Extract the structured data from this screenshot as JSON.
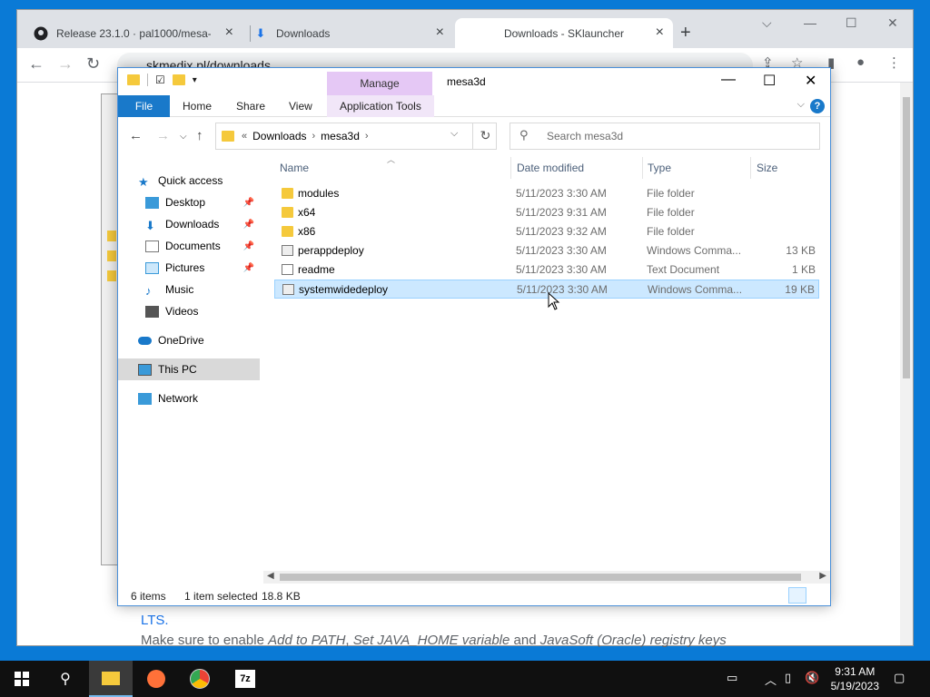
{
  "browser": {
    "tabs": [
      {
        "title": "Release 23.1.0 · pal1000/mesa-d",
        "icon": "github-icon"
      },
      {
        "title": "Downloads",
        "icon": "download-icon"
      },
      {
        "title": "Downloads - SKlauncher",
        "icon": "none"
      }
    ],
    "url": "skmedix.pl/downloads",
    "page": {
      "lts_link": "LTS.",
      "instruction_prefix": "Make sure to enable ",
      "opt1": "Add to PATH",
      "comma": ", ",
      "opt2": "Set JAVA_HOME variable",
      "and": " and ",
      "opt3": "JavaSoft (Oracle) registry keys"
    }
  },
  "explorer": {
    "title": "mesa3d",
    "context_tab": "Manage",
    "ribbon_tabs": [
      "File",
      "Home",
      "Share",
      "View",
      "Application Tools"
    ],
    "breadcrumb": [
      "Downloads",
      "mesa3d"
    ],
    "breadcrumb_prefix": "«",
    "search_placeholder": "Search mesa3d",
    "nav": [
      {
        "label": "Quick access",
        "icon": "star-icon"
      },
      {
        "label": "Desktop",
        "icon": "desktop-icon",
        "pinned": true
      },
      {
        "label": "Downloads",
        "icon": "download-arrow-icon",
        "pinned": true
      },
      {
        "label": "Documents",
        "icon": "document-icon",
        "pinned": true
      },
      {
        "label": "Pictures",
        "icon": "picture-icon",
        "pinned": true
      },
      {
        "label": "Music",
        "icon": "music-icon"
      },
      {
        "label": "Videos",
        "icon": "video-icon"
      },
      {
        "label": "OneDrive",
        "icon": "cloud-icon"
      },
      {
        "label": "This PC",
        "icon": "computer-icon",
        "selected": true
      },
      {
        "label": "Network",
        "icon": "network-icon"
      }
    ],
    "columns": [
      "Name",
      "Date modified",
      "Type",
      "Size"
    ],
    "files": [
      {
        "name": "modules",
        "date": "5/11/2023 3:30 AM",
        "type": "File folder",
        "size": "",
        "kind": "folder"
      },
      {
        "name": "x64",
        "date": "5/11/2023 9:31 AM",
        "type": "File folder",
        "size": "",
        "kind": "folder"
      },
      {
        "name": "x86",
        "date": "5/11/2023 9:32 AM",
        "type": "File folder",
        "size": "",
        "kind": "folder"
      },
      {
        "name": "perappdeploy",
        "date": "5/11/2023 3:30 AM",
        "type": "Windows Comma...",
        "size": "13 KB",
        "kind": "cmd"
      },
      {
        "name": "readme",
        "date": "5/11/2023 3:30 AM",
        "type": "Text Document",
        "size": "1 KB",
        "kind": "txt"
      },
      {
        "name": "systemwidedeploy",
        "date": "5/11/2023 3:30 AM",
        "type": "Windows Comma...",
        "size": "19 KB",
        "kind": "cmd",
        "selected": true
      }
    ],
    "status": {
      "items": "6 items",
      "selected": "1 item selected",
      "size": "18.8 KB"
    }
  },
  "taskbar": {
    "time": "9:31 AM",
    "date": "5/19/2023",
    "apps": [
      "file-explorer-icon",
      "firefox-icon",
      "chrome-icon",
      "7zip-icon"
    ]
  },
  "colors": {
    "accent": "#1979ca",
    "manage": "#e5c8f5",
    "selection": "#cce8ff",
    "folder": "#f5c93c"
  }
}
